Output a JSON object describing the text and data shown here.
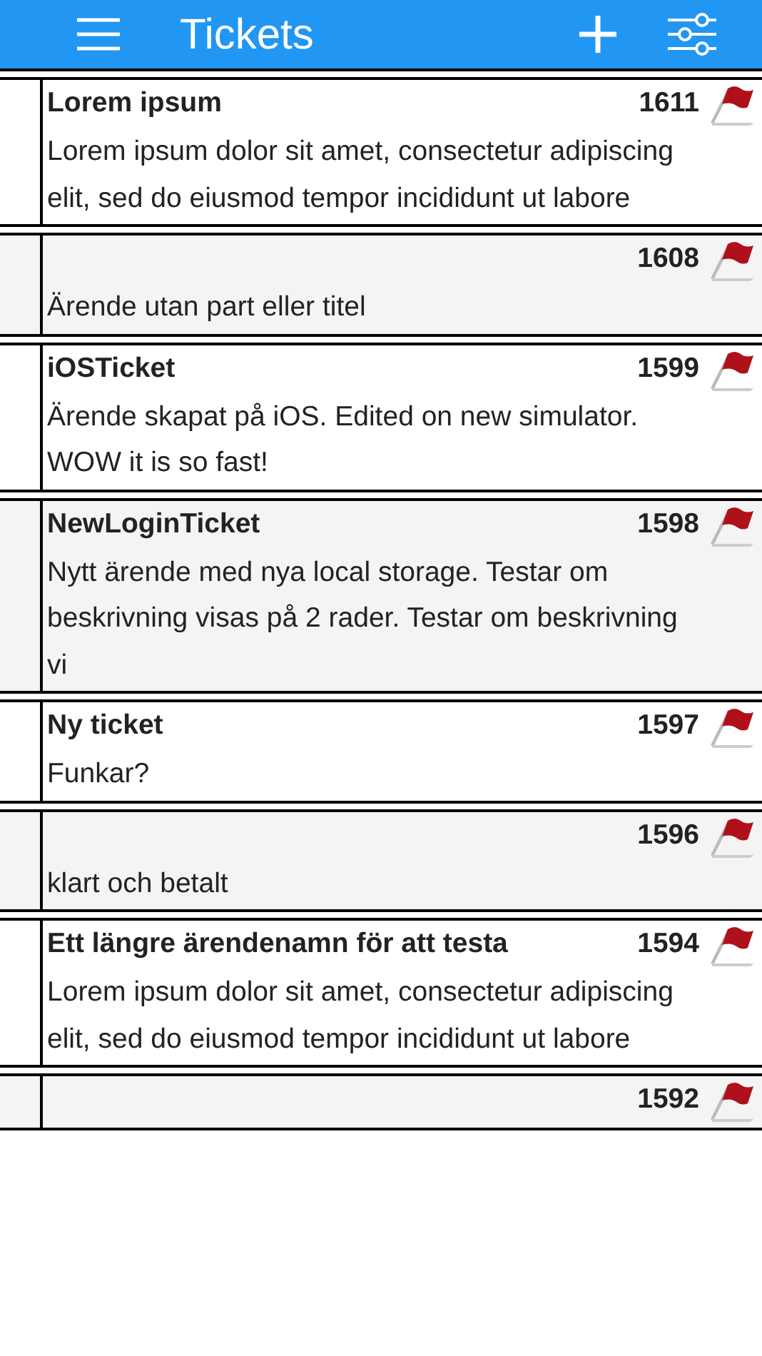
{
  "header": {
    "title": "Tickets"
  },
  "tickets": [
    {
      "title": "Lorem ipsum",
      "number": "1611",
      "description": "Lorem ipsum dolor sit amet, consectetur adipiscing elit, sed do eiusmod tempor incididunt ut labore"
    },
    {
      "number": "1608",
      "description": "Ärende utan part eller titel"
    },
    {
      "title": "iOSTicket",
      "number": "1599",
      "description": "Ärende skapat på iOS. Edited on new simulator. WOW it is so fast!"
    },
    {
      "title": "NewLoginTicket",
      "number": "1598",
      "description": "Nytt ärende med nya local storage. Testar om beskrivning visas på 2 rader. Testar om beskrivning vi"
    },
    {
      "title": "Ny ticket",
      "number": "1597",
      "description": "Funkar?"
    },
    {
      "number": "1596",
      "description": "klart och betalt"
    },
    {
      "title": "Ett längre ärendenamn för att testa",
      "number": "1594",
      "description": "Lorem ipsum dolor sit amet, consectetur adipiscing elit, sed do eiusmod tempor incididunt ut labore"
    },
    {
      "number": "1592"
    }
  ]
}
